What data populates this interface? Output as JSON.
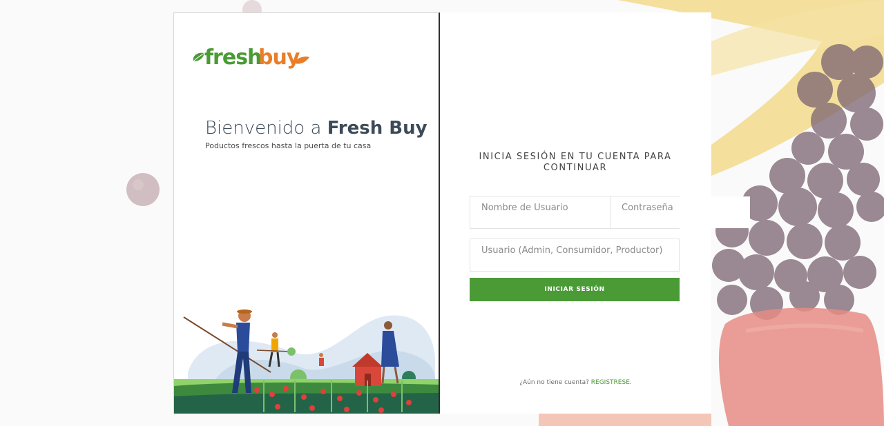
{
  "logo": {
    "fresh": "fresh",
    "buy": "buy",
    "fresh_color": "#4a9b36",
    "buy_color": "#e87e2a"
  },
  "welcome": {
    "title_prefix": "Bienvenido a ",
    "title_brand": "Fresh Buy",
    "subtitle": "Poductos frescos hasta la puerta de tu casa"
  },
  "form": {
    "heading": "INICIA SESIÓN EN TU CUENTA PARA CONTINUAR",
    "username_placeholder": "Nombre de Usuario",
    "password_placeholder": "Contraseña",
    "role_placeholder": "Usuario (Admin, Consumidor, Productor)",
    "submit_label": "INICIAR SESIÓN",
    "register_prompt": "¿Aún no tiene cuenta? ",
    "register_link": "REGISTRESE."
  },
  "colors": {
    "accent": "#4a9b36",
    "brand_orange": "#e87e2a",
    "text_dark": "#3d4a57"
  }
}
